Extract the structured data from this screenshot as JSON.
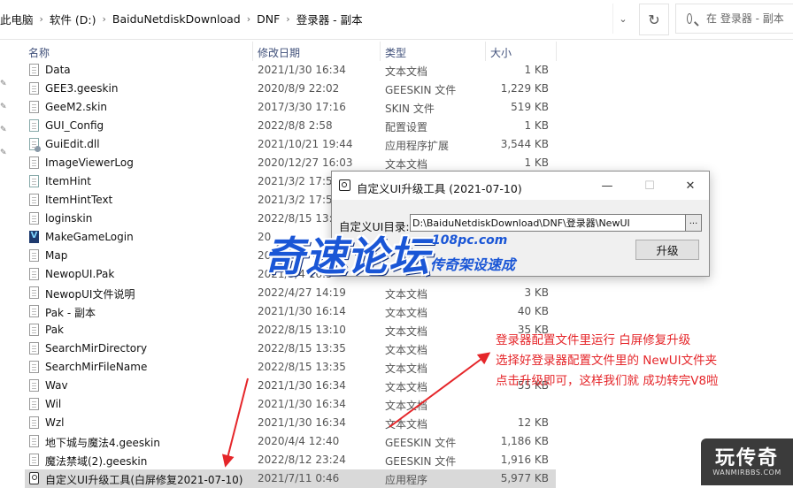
{
  "address_bar": {
    "breadcrumbs": [
      "此电脑",
      "软件 (D:)",
      "BaiduNetdiskDownload",
      "DNF",
      "登录器 - 副本"
    ],
    "search_placeholder": "在 登录器 - 副本"
  },
  "columns": {
    "name": "名称",
    "date": "修改日期",
    "type": "类型",
    "size": "大小"
  },
  "files": [
    {
      "name": "Data",
      "date": "2021/1/30 16:34",
      "type": "文本文档",
      "size": "1 KB",
      "icon": "text-file-icon"
    },
    {
      "name": "GEE3.geeskin",
      "date": "2020/8/9 22:02",
      "type": "GEESKIN 文件",
      "size": "1,229 KB",
      "icon": "file-icon"
    },
    {
      "name": "GeeM2.skin",
      "date": "2017/3/30 17:16",
      "type": "SKIN 文件",
      "size": "519 KB",
      "icon": "file-icon"
    },
    {
      "name": "GUI_Config",
      "date": "2022/8/8 2:58",
      "type": "配置设置",
      "size": "1 KB",
      "icon": "config-file-icon"
    },
    {
      "name": "GuiEdit.dll",
      "date": "2021/10/21 19:44",
      "type": "应用程序扩展",
      "size": "3,544 KB",
      "icon": "dll-file-icon"
    },
    {
      "name": "ImageViewerLog",
      "date": "2020/12/27 16:03",
      "type": "文本文档",
      "size": "1 KB",
      "icon": "text-file-icon"
    },
    {
      "name": "ItemHint",
      "date": "2021/3/2 17:57",
      "type": "",
      "size": "",
      "icon": "config-file-icon"
    },
    {
      "name": "ItemHintText",
      "date": "2021/3/2 17:57",
      "type": "",
      "size": "",
      "icon": "text-file-icon"
    },
    {
      "name": "loginskin",
      "date": "2022/8/15 13:2",
      "type": "",
      "size": "",
      "icon": "file-icon"
    },
    {
      "name": "MakeGameLogin",
      "date": "20",
      "type": "",
      "size": "",
      "icon": "vs-app-icon"
    },
    {
      "name": "Map",
      "date": "20",
      "type": "",
      "size": "",
      "icon": "file-icon"
    },
    {
      "name": "NewopUI.Pak",
      "date": "2021/3/4 16:5",
      "type": "",
      "size": "",
      "icon": "file-icon"
    },
    {
      "name": "NewopUI文件说明",
      "date": "2022/4/27 14:19",
      "type": "文本文档",
      "size": "3 KB",
      "icon": "text-file-icon"
    },
    {
      "name": "Pak - 副本",
      "date": "2021/1/30 16:14",
      "type": "文本文档",
      "size": "40 KB",
      "icon": "text-file-icon"
    },
    {
      "name": "Pak",
      "date": "2022/8/15 13:10",
      "type": "文本文档",
      "size": "35 KB",
      "icon": "text-file-icon"
    },
    {
      "name": "SearchMirDirectory",
      "date": "2022/8/15 13:35",
      "type": "文本文档",
      "size": "",
      "icon": "text-file-icon"
    },
    {
      "name": "SearchMirFileName",
      "date": "2022/8/15 13:35",
      "type": "文本文档",
      "size": "",
      "icon": "text-file-icon"
    },
    {
      "name": "Wav",
      "date": "2021/1/30 16:34",
      "type": "文本文档",
      "size": "55 KB",
      "icon": "text-file-icon"
    },
    {
      "name": "Wil",
      "date": "2021/1/30 16:34",
      "type": "文本文档",
      "size": "",
      "icon": "text-file-icon"
    },
    {
      "name": "Wzl",
      "date": "2021/1/30 16:34",
      "type": "文本文档",
      "size": "12 KB",
      "icon": "text-file-icon"
    },
    {
      "name": "地下城与魔法4.geeskin",
      "date": "2020/4/4 12:40",
      "type": "GEESKIN 文件",
      "size": "1,186 KB",
      "icon": "file-icon"
    },
    {
      "name": "魔法禁域(2).geeskin",
      "date": "2022/8/12 23:24",
      "type": "GEESKIN 文件",
      "size": "1,916 KB",
      "icon": "file-icon"
    },
    {
      "name": "自定义UI升级工具(白屏修复2021-07-10)",
      "date": "2021/7/11 0:46",
      "type": "应用程序",
      "size": "5,977 KB",
      "icon": "app-icon",
      "selected": true
    }
  ],
  "dialog": {
    "title": "自定义UI升级工具 (2021-07-10)",
    "minimize": "—",
    "maximize": "☐",
    "close": "✕",
    "dir_label": "自定义UI目录:",
    "dir_value": "D:\\BaiduNetdiskDownload\\DNF\\登录器\\NewUI",
    "browse_label": "...",
    "upgrade_label": "升级"
  },
  "watermark": {
    "brand": "奇速论坛",
    "url": "108pc.com",
    "slogan": "传奇架设速成"
  },
  "annotation": {
    "lines": [
      "登录器配置文件里运行 白屏修复升级",
      "选择好登录器配置文件里的 NewUI文件夹",
      "点击升级即可，这样我们就 成功转完V8啦"
    ],
    "color": "#e5262a"
  },
  "corner_badge": {
    "title": "玩传奇",
    "subtitle": "WANMIRBBS.COM"
  }
}
